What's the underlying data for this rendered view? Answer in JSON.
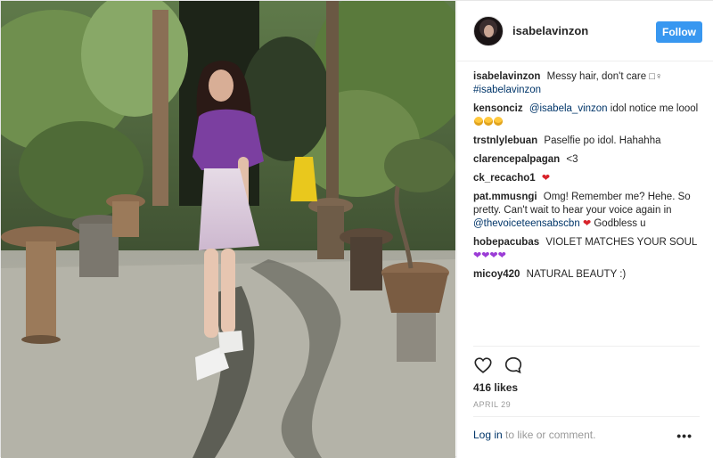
{
  "header": {
    "username": "isabelavinzon",
    "follow_label": "Follow"
  },
  "caption": {
    "username": "isabelavinzon",
    "text": "Messy hair, don't care",
    "glyphs": "□♀",
    "hashtag": "#isabelavinzon"
  },
  "comments": [
    {
      "username": "kensonciz",
      "mention": "@isabela_vinzon",
      "text": "idol notice me loool"
    },
    {
      "username": "trstnlylebuan",
      "text": "Paselfie po idol. Hahahha"
    },
    {
      "username": "clarencepalpagan",
      "text": "<3"
    },
    {
      "username": "ck_recacho1",
      "text": ""
    },
    {
      "username": "pat.mmusngi",
      "text": "Omg! Remember me? Hehe. So pretty. Can't wait to hear your voice again in",
      "mention": "@thevoiceteensabscbn",
      "text2": "Godbless u"
    },
    {
      "username": "hobepacubas",
      "text": "VIOLET MATCHES YOUR SOUL"
    },
    {
      "username": "micoy420",
      "text": "NATURAL BEAUTY :)"
    }
  ],
  "likes": "416 likes",
  "date": "APRIL 29",
  "footer": {
    "login": "Log in",
    "rest": " to like or comment.",
    "more": "•••"
  },
  "icons": {
    "like": "heart-outline-icon",
    "comment": "speech-bubble-icon"
  },
  "colors": {
    "accent": "#3897f0",
    "link": "#003569",
    "laugh_emoji": "#ffc83d",
    "red_heart": "#d8232a",
    "purple_heart": "#9b3cd6",
    "dress_purple": "#7b3fa0"
  }
}
